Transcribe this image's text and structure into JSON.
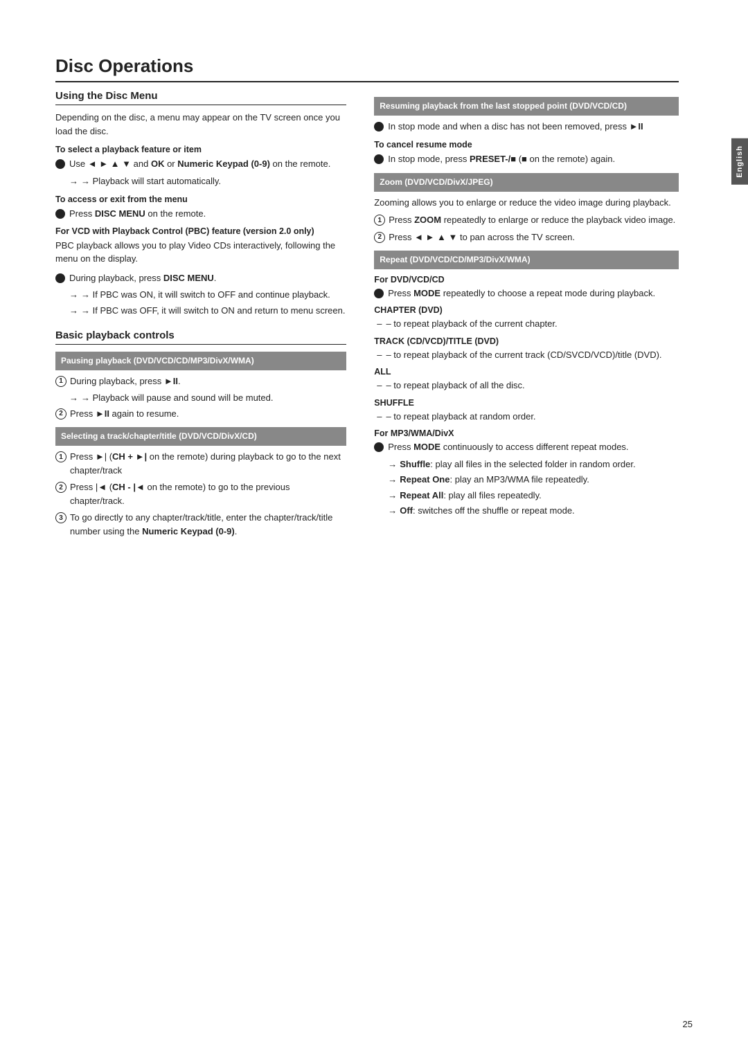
{
  "page": {
    "title": "Disc Operations",
    "page_number": "25",
    "side_tab": "English"
  },
  "left_col": {
    "using_disc_menu": {
      "heading": "Using the Disc Menu",
      "intro": "Depending on the disc, a menu may appear on the TV screen once you load the disc.",
      "select_feature_heading": "To select a playback feature or item",
      "select_feature_bullet": "Use ◄ ► ▲ ▼ and OK or Numeric Keypad (0-9) on the remote.",
      "select_feature_arrow": "→ Playback will start automatically.",
      "access_menu_heading": "To access or exit from the menu",
      "access_menu_bullet": "Press DISC MENU on the remote.",
      "pbc_heading": "For VCD with Playback Control (PBC) feature (version 2.0 only)",
      "pbc_body": "PBC playback allows you to play Video CDs interactively, following the menu on the display.",
      "pbc_bullet": "During playback, press DISC MENU.",
      "pbc_arrow1": "→ If PBC was ON, it will switch to OFF and continue playback.",
      "pbc_arrow2": "→ If PBC was OFF, it will switch to ON and return to menu screen."
    },
    "basic_playback": {
      "heading": "Basic playback controls",
      "pausing_box": "Pausing playback (DVD/VCD/CD/MP3/DivX/WMA)",
      "pausing_step1": "During playback, press ►II.",
      "pausing_step1_arrow": "→ Playback will pause and sound will be muted.",
      "pausing_step2": "Press ►II again to resume.",
      "selecting_box": "Selecting a track/chapter/title (DVD/VCD/DivX/CD)",
      "selecting_step1": "Press ►| (CH + ►| on the remote) during playback to go to the next chapter/track",
      "selecting_step2": "Press |◄ (CH - |◄ on the remote) to go to the previous chapter/track.",
      "selecting_step3": "To go directly to any chapter/track/title, enter the chapter/track/title number using the Numeric Keypad (0-9)."
    }
  },
  "right_col": {
    "resuming_box": "Resuming playback from the last stopped point (DVD/VCD/CD)",
    "resuming_bullet": "In stop mode and when a disc has not been removed, press ►II",
    "cancel_resume_heading": "To cancel resume mode",
    "cancel_resume_bullet": "In stop mode, press PRESET-/■ (■ on the remote) again.",
    "zoom_box": "Zoom (DVD/VCD/DivX/JPEG)",
    "zoom_body": "Zooming allows you to enlarge or reduce the video image during playback.",
    "zoom_step1": "Press ZOOM repeatedly to enlarge or reduce the playback video image.",
    "zoom_step2": "Press ◄ ► ▲ ▼ to pan across the TV screen.",
    "repeat_box": "Repeat (DVD/VCD/CD/MP3/DivX/WMA)",
    "for_dvd_heading": "For DVD/VCD/CD",
    "for_dvd_bullet": "Press MODE repeatedly to choose a repeat mode during playback.",
    "chapter_dvd_heading": "CHAPTER (DVD)",
    "chapter_dvd_dash": "– to repeat playback of the current chapter.",
    "track_cd_heading": "TRACK (CD/VCD)/TITLE (DVD)",
    "track_cd_dash": "– to repeat playback of the current track (CD/SVCD/VCD)/title (DVD).",
    "all_heading": "ALL",
    "all_dash": "– to repeat playback of all the disc.",
    "shuffle_heading": "SHUFFLE",
    "shuffle_dash": "– to repeat playback at random order.",
    "for_mp3_heading": "For MP3/WMA/DivX",
    "for_mp3_bullet": "Press MODE continuously to access different repeat modes.",
    "mp3_arrow1": "→ Shuffle: play all files in the selected folder in random order.",
    "mp3_arrow2": "→ Repeat One: play an MP3/WMA file repeatedly.",
    "mp3_arrow3": "→ Repeat All: play all files repeatedly.",
    "mp3_arrow4": "→ Off: switches off the shuffle or repeat mode."
  }
}
